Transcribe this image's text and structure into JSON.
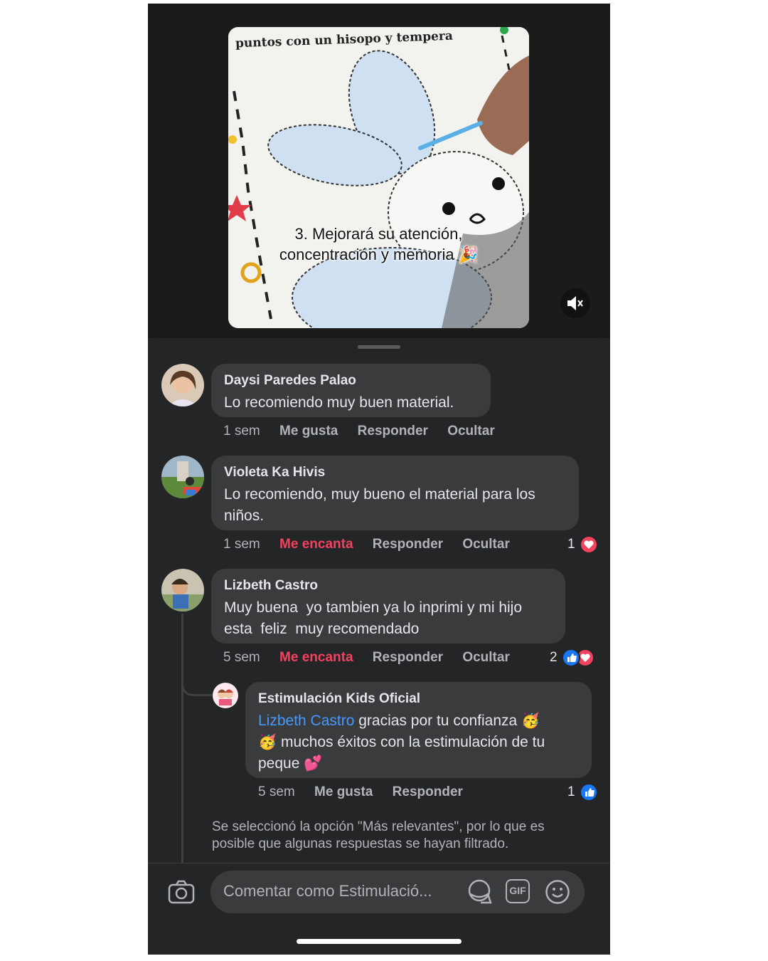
{
  "video": {
    "top_text": "puntos con un hisopo y tempera",
    "caption_line1": "3. Mejorará su atención,",
    "caption_line2": "concentración y memoria",
    "caption_emoji": "🎉"
  },
  "comments": [
    {
      "name": "Daysi Paredes Palao",
      "text": "Lo recomiendo muy buen material.",
      "time": "1 sem",
      "like": "Me gusta",
      "reply": "Responder",
      "hide": "Ocultar"
    },
    {
      "name": "Violeta Ka Hivis",
      "text_line1": "Lo recomiendo, muy bueno el material para los",
      "text_line2": "niños.",
      "time": "1 sem",
      "like": "Me encanta",
      "reply": "Responder",
      "hide": "Ocultar",
      "reaction_count": "1"
    },
    {
      "name": "Lizbeth Castro",
      "text_line1": "Muy buena  yo tambien ya lo inprimi y mi hijo",
      "text_line2": "esta  feliz  muy recomendado",
      "time": "5 sem",
      "like": "Me encanta",
      "reply": "Responder",
      "hide": "Ocultar",
      "reaction_count": "2"
    }
  ],
  "reply": {
    "name": "Estimulación Kids Oficial",
    "mention": "Lizbeth Castro",
    "text_a": "gracias por tu confianza",
    "emoji_a": "🥳",
    "emoji_b": "🥳",
    "text_b": "muchos éxitos con la estimulación de tu",
    "text_c": "peque",
    "emoji_c": "💕",
    "time": "5 sem",
    "like": "Me gusta",
    "reply": "Responder",
    "reaction_count": "1"
  },
  "notice": "Se seleccionó la opción \"Más relevantes\", por lo que es posible que algunas respuestas se hayan filtrado.",
  "composer": {
    "placeholder": "Comentar como Estimulació...",
    "gif_label": "GIF"
  },
  "colors": {
    "background": "#242526",
    "bubble": "#3a3b3c",
    "love": "#f3425f",
    "like": "#1877f2",
    "mention": "#4599ff"
  }
}
